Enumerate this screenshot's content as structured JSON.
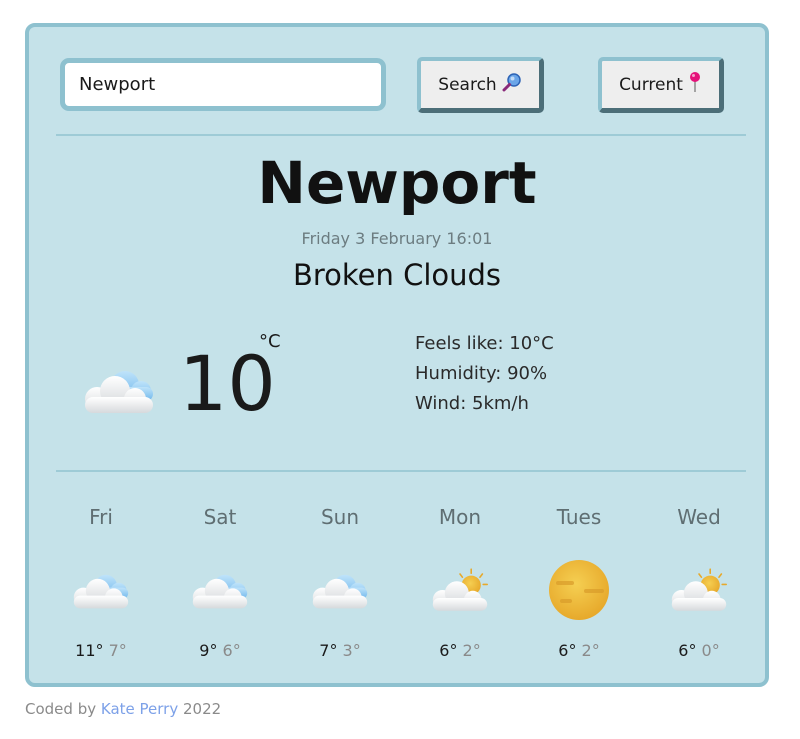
{
  "search": {
    "value": "Newport",
    "button_label": "Search",
    "button_icon": "magnifying-glass-icon"
  },
  "current_button": {
    "label": "Current",
    "icon": "pushpin-icon"
  },
  "weather": {
    "city": "Newport",
    "datetime": "Friday 3 February 16:01",
    "description": "Broken Clouds",
    "temperature": "10",
    "unit": "°C",
    "icon": "broken-clouds-icon",
    "feels_like": "Feels like: 10°C",
    "humidity": "Humidity: 90%",
    "wind": "Wind: 5km/h"
  },
  "forecast": [
    {
      "day": "Fri",
      "max": "11°",
      "min": "7°",
      "icon": "broken-clouds-icon"
    },
    {
      "day": "Sat",
      "max": "9°",
      "min": "6°",
      "icon": "broken-clouds-icon"
    },
    {
      "day": "Sun",
      "max": "7°",
      "min": "3°",
      "icon": "broken-clouds-icon"
    },
    {
      "day": "Mon",
      "max": "6°",
      "min": "2°",
      "icon": "partly-sunny-icon"
    },
    {
      "day": "Tues",
      "max": "6°",
      "min": "2°",
      "icon": "hazy-sun-icon"
    },
    {
      "day": "Wed",
      "max": "6°",
      "min": "0°",
      "icon": "partly-sunny-icon"
    }
  ],
  "footer": {
    "prefix": "Coded by",
    "author": "Kate Perry",
    "year": "2022"
  },
  "colors": {
    "card_bg": "#c5e2e9",
    "card_border": "#8ec1cf",
    "link": "#7da1e8"
  }
}
